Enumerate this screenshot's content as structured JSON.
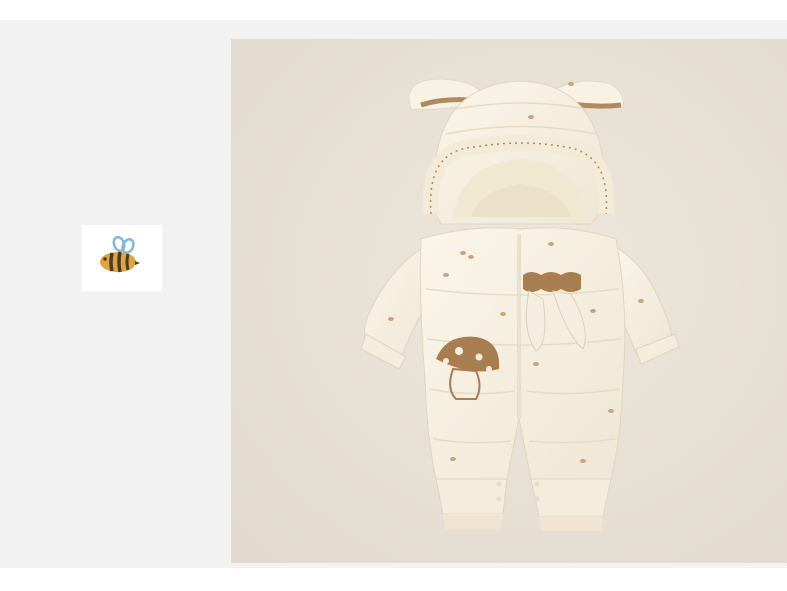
{
  "gallery": {
    "thumbnail_icon": "bee-icon",
    "main_image": "baby-snowsuit-romper-photo",
    "colors": {
      "page_background": "#f2f2f2",
      "photo_background": "#e8e1d6",
      "garment": "#f7f0e2",
      "accent_brown": "#a87e50",
      "bee_yellow": "#e0a43a",
      "bee_wing": "#7fb7dd"
    }
  }
}
